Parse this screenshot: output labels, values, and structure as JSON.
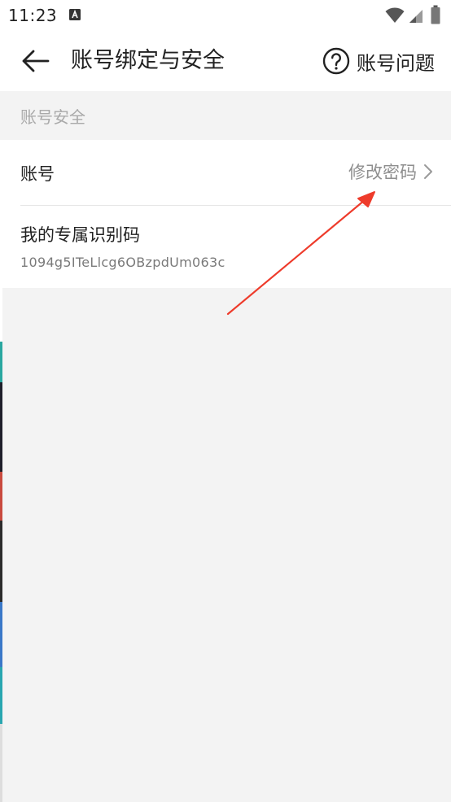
{
  "status_bar": {
    "time": "11:23",
    "icons": [
      "app-a-icon",
      "wifi-icon",
      "signal-icon",
      "battery-icon"
    ]
  },
  "header": {
    "back_icon": "arrow-left-icon",
    "title": "账号绑定与安全",
    "help_icon": "question-circle-icon",
    "help_label": "账号问题"
  },
  "section": {
    "title": "账号安全"
  },
  "rows": {
    "account": {
      "label": "账号",
      "action_label": "修改密码",
      "action_icon": "chevron-right-icon"
    },
    "identifier": {
      "label": "我的专属识别码",
      "value": "1094g5ITeLlcg6OBzpdUm063c"
    }
  },
  "colors": {
    "primary_text": "#222222",
    "secondary_text": "#8e8e8e",
    "section_text": "#a9a9a9",
    "background": "#f3f3f3",
    "card": "#ffffff",
    "annotation_arrow": "#ee3b2b"
  }
}
